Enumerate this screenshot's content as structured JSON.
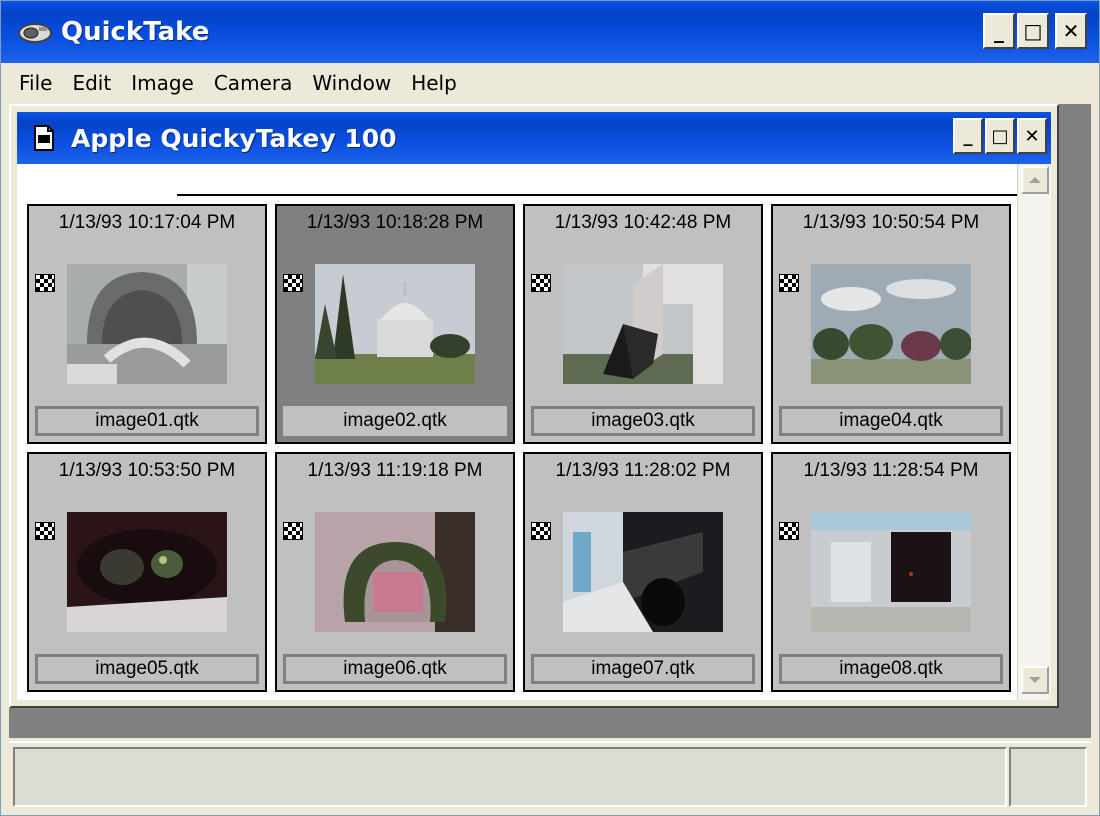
{
  "app": {
    "title": "QuickTake",
    "icon": "camera-icon",
    "window_buttons": {
      "minimize": "_",
      "maximize": "□",
      "close": "✕"
    }
  },
  "menubar": {
    "items": [
      "File",
      "Edit",
      "Image",
      "Camera",
      "Window",
      "Help"
    ]
  },
  "child_window": {
    "title": "Apple QuickyTakey 100",
    "icon": "document-icon",
    "window_buttons": {
      "minimize": "_",
      "maximize": "□",
      "close": "✕"
    }
  },
  "images": [
    {
      "date": "1/13/93 10:17:04 PM",
      "filename": "image01.qtk",
      "selected": false
    },
    {
      "date": "1/13/93 10:18:28 PM",
      "filename": "image02.qtk",
      "selected": true
    },
    {
      "date": "1/13/93 10:42:48 PM",
      "filename": "image03.qtk",
      "selected": false
    },
    {
      "date": "1/13/93 10:50:54 PM",
      "filename": "image04.qtk",
      "selected": false
    },
    {
      "date": "1/13/93 10:53:50 PM",
      "filename": "image05.qtk",
      "selected": false
    },
    {
      "date": "1/13/93 11:19:18 PM",
      "filename": "image06.qtk",
      "selected": false
    },
    {
      "date": "1/13/93 11:28:02 PM",
      "filename": "image07.qtk",
      "selected": false
    },
    {
      "date": "1/13/93 11:28:54 PM",
      "filename": "image08.qtk",
      "selected": false
    }
  ],
  "colors": {
    "titlebar": "#0a4fe0",
    "selected_card": "#808080",
    "card": "#c0c0c0"
  }
}
